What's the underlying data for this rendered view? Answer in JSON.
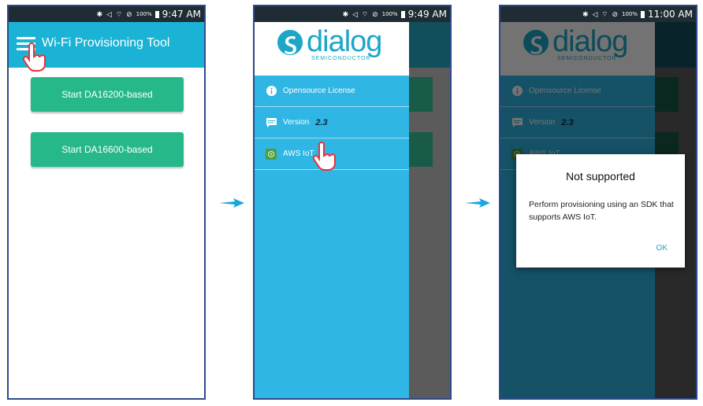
{
  "status_bars": [
    {
      "icons": "✱ ◁ ⌔ ⊘",
      "battery": "100%",
      "time": "9:47 AM"
    },
    {
      "icons": "✱ ◁ ⌔ ⊘",
      "battery": "100%",
      "time": "9:49 AM"
    },
    {
      "icons": "✱ ◁ ⌔ ⊘",
      "battery": "100%",
      "time": "11:00 AM"
    }
  ],
  "panel1": {
    "title": "Wi-Fi Provisioning Tool",
    "buttons": [
      "Start DA16200-based",
      "Start DA16600-based"
    ]
  },
  "drawer": {
    "logo_text": "dialog",
    "logo_sub": "SEMICONDUCTOR",
    "items": [
      {
        "label": "Opensource License",
        "icon": "info-icon"
      },
      {
        "label": "Version",
        "value": "2.3",
        "icon": "message-icon"
      },
      {
        "label": "AWS IoT",
        "icon": "aws-iot-icon"
      }
    ]
  },
  "dialog": {
    "title": "Not supported",
    "message": "Perform provisioning using an SDK that supports AWS IoT.",
    "ok_label": "OK"
  },
  "colors": {
    "appbar": "#1ab3d6",
    "button": "#26b88a",
    "drawer": "#2fb6e4",
    "arrow": "#1aa6e0",
    "hand": "#e8323c"
  }
}
